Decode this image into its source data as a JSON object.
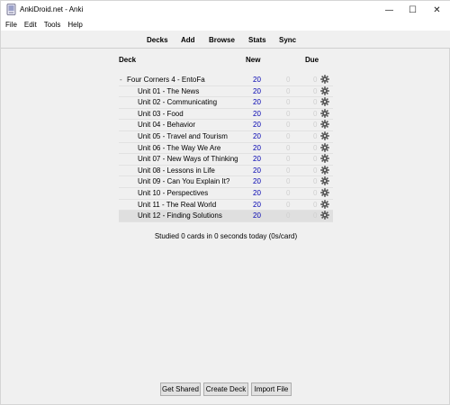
{
  "window": {
    "title": "AnkiDroid.net - Anki",
    "minimize_glyph": "—",
    "maximize_glyph": "☐",
    "close_glyph": "✕"
  },
  "menu": [
    "File",
    "Edit",
    "Tools",
    "Help"
  ],
  "toolbar": [
    "Decks",
    "Add",
    "Browse",
    "Stats",
    "Sync"
  ],
  "table": {
    "headers": {
      "deck": "Deck",
      "new": "New",
      "due": "Due"
    },
    "collapse_glyph": "-",
    "rows": [
      {
        "name": "Four Corners 4 - EntoFa",
        "new": "20",
        "learn": "0",
        "due": "0",
        "level": 0
      },
      {
        "name": "Unit 01 - The News",
        "new": "20",
        "learn": "0",
        "due": "0",
        "level": 1
      },
      {
        "name": "Unit 02 - Communicating",
        "new": "20",
        "learn": "0",
        "due": "0",
        "level": 1
      },
      {
        "name": "Unit 03 - Food",
        "new": "20",
        "learn": "0",
        "due": "0",
        "level": 1
      },
      {
        "name": "Unit 04 - Behavior",
        "new": "20",
        "learn": "0",
        "due": "0",
        "level": 1
      },
      {
        "name": "Unit 05 - Travel and Tourism",
        "new": "20",
        "learn": "0",
        "due": "0",
        "level": 1
      },
      {
        "name": "Unit 06 - The Way We Are",
        "new": "20",
        "learn": "0",
        "due": "0",
        "level": 1
      },
      {
        "name": "Unit 07 - New Ways of Thinking",
        "new": "20",
        "learn": "0",
        "due": "0",
        "level": 1
      },
      {
        "name": "Unit 08 - Lessons in Life",
        "new": "20",
        "learn": "0",
        "due": "0",
        "level": 1
      },
      {
        "name": "Unit 09 - Can You Explain It?",
        "new": "20",
        "learn": "0",
        "due": "0",
        "level": 1
      },
      {
        "name": "Unit 10 - Perspectives",
        "new": "20",
        "learn": "0",
        "due": "0",
        "level": 1
      },
      {
        "name": "Unit 11 - The Real World",
        "new": "20",
        "learn": "0",
        "due": "0",
        "level": 1
      },
      {
        "name": "Unit 12 - Finding Solutions",
        "new": "20",
        "learn": "0",
        "due": "0",
        "level": 1,
        "current": true
      }
    ]
  },
  "studied_text": "Studied 0 cards in 0 seconds today (0s/card)",
  "buttons": {
    "get_shared": "Get Shared",
    "create_deck": "Create Deck",
    "import_file": "Import File"
  },
  "icons": {
    "app": "anki-app-icon",
    "gear": "gear-icon"
  },
  "colors": {
    "new_count": "#0000b0",
    "zero_count": "#d0d0d0",
    "current_row": "#dfdfdf"
  }
}
